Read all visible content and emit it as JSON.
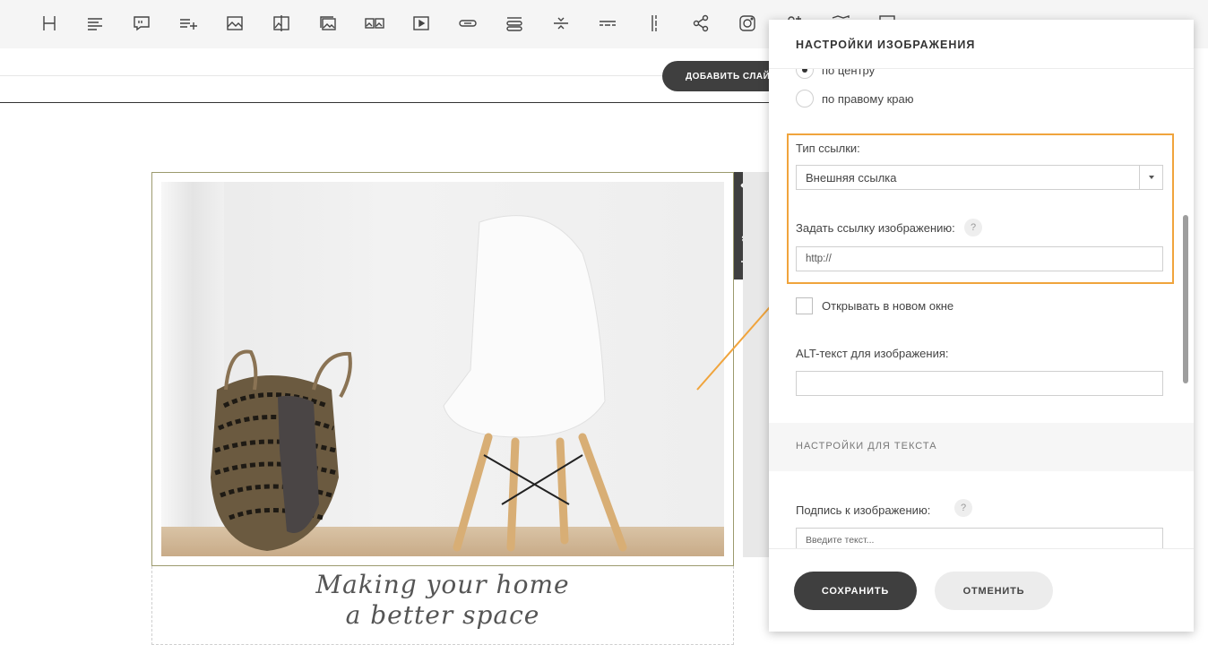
{
  "toolbar": {
    "tools": [
      {
        "name": "heading-icon"
      },
      {
        "name": "paragraph-icon"
      },
      {
        "name": "quote-icon"
      },
      {
        "name": "list-add-icon"
      },
      {
        "name": "image-icon"
      },
      {
        "name": "image-compare-icon"
      },
      {
        "name": "gallery-icon"
      },
      {
        "name": "image-pair-icon"
      },
      {
        "name": "video-icon"
      },
      {
        "name": "button-icon"
      },
      {
        "name": "buttons-icon"
      },
      {
        "name": "separator-icon"
      },
      {
        "name": "dash-divider-icon"
      },
      {
        "name": "vertical-divider-icon"
      },
      {
        "name": "share-icon"
      },
      {
        "name": "instagram-icon"
      },
      {
        "name": "follow-icon"
      },
      {
        "name": "map-icon"
      },
      {
        "name": "embed-icon"
      }
    ]
  },
  "canvas": {
    "add_slide_label": "ДОБАВИТЬ СЛАЙД",
    "caption_line1": "Making your home",
    "caption_line2": "a better space"
  },
  "panel": {
    "title": "НАСТРОЙКИ ИЗОБРАЖЕНИЯ",
    "align_center_label": "по центру",
    "align_right_label": "по правому краю",
    "link_type_label": "Тип ссылки:",
    "link_type_value": "Внешняя ссылка",
    "image_link_label": "Задать ссылку изображению:",
    "image_link_value": "http://",
    "open_new_window_label": "Открывать в новом окне",
    "alt_label": "ALT-текст для изображения:",
    "alt_value": "",
    "text_settings_title": "НАСТРОЙКИ ДЛЯ ТЕКСТА",
    "caption_label": "Подпись к изображению:",
    "caption_placeholder": "Введите текст...",
    "help_symbol": "?",
    "save_label": "СОХРАНИТЬ",
    "cancel_label": "ОТМЕНИТЬ"
  },
  "colors": {
    "highlight": "#f0a43c",
    "dark_button": "#3f3f3f"
  }
}
